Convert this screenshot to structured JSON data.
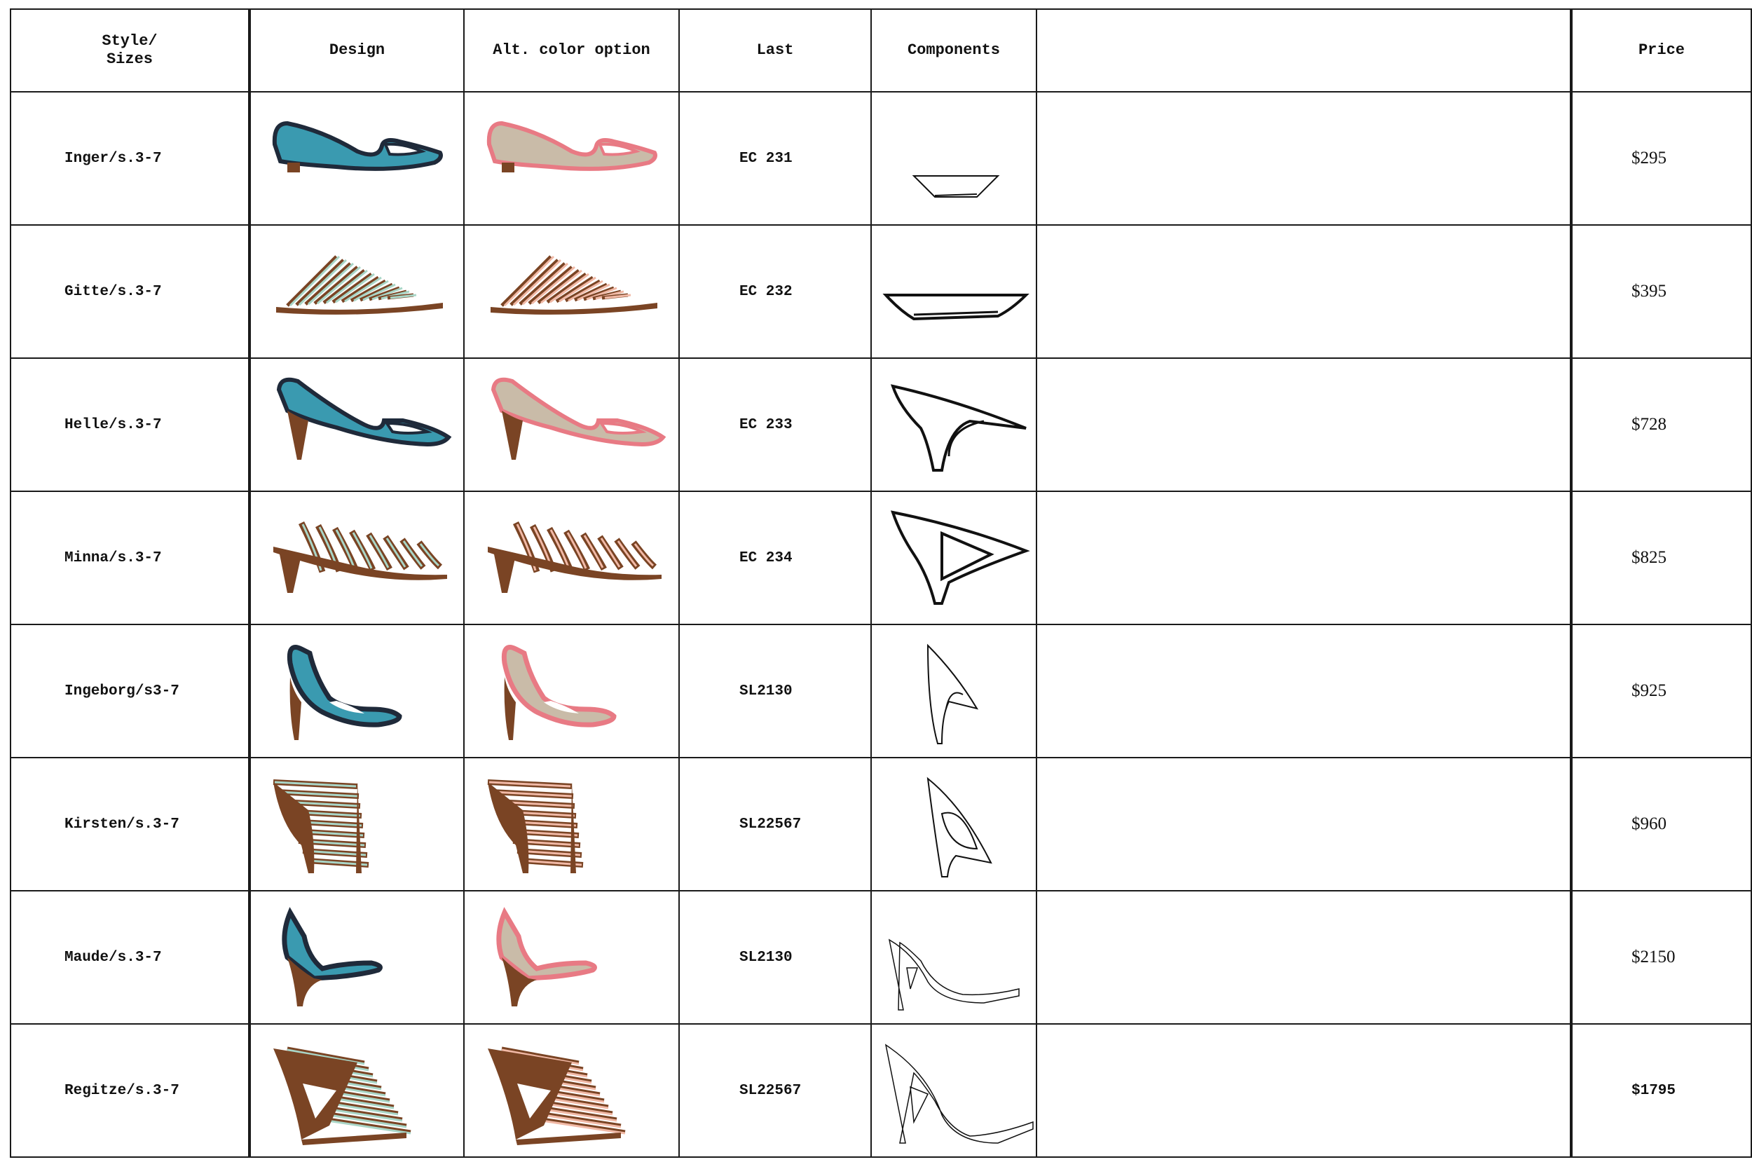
{
  "headers": {
    "style": "Style/\nSizes",
    "design": "Design",
    "alt": "Alt. color option",
    "last": "Last",
    "components": "Components",
    "blank": "",
    "price": "Price"
  },
  "colors": {
    "design_main": "#3a9ab0",
    "design_trim": "#1f2a3a",
    "alt_main": "#c9bba8",
    "alt_trim": "#e87a84",
    "wood": "#7a4424",
    "strap_green": "#a9d6c7",
    "strap_pink": "#f1b9a6"
  },
  "rows": [
    {
      "style": "Inger/s.3-7",
      "last": "EC 231",
      "price": "$295",
      "shoe": "flat",
      "comp": "sole-small",
      "icon": "flat-shoe-icon"
    },
    {
      "style": "Gitte/s.3-7",
      "last": "EC 232",
      "price": "$395",
      "shoe": "strappy-flat",
      "comp": "sole-large",
      "icon": "strappy-flat-icon"
    },
    {
      "style": "Helle/s.3-7",
      "last": "EC 233",
      "price": "$728",
      "shoe": "kitten-heel",
      "comp": "heel-curve",
      "icon": "kitten-heel-icon"
    },
    {
      "style": "Minna/s.3-7",
      "last": "EC 234",
      "price": "$825",
      "shoe": "strappy-kitten",
      "comp": "heel-triangle",
      "icon": "strappy-kitten-icon"
    },
    {
      "style": "Ingeborg/s3-7",
      "last": "SL2130",
      "price": "$925",
      "shoe": "pump",
      "comp": "heel-narrow",
      "icon": "pump-icon"
    },
    {
      "style": "Kirsten/s.3-7",
      "last": "SL22567",
      "price": "$960",
      "shoe": "cage-heel",
      "comp": "heel-cutout",
      "icon": "cage-heel-icon"
    },
    {
      "style": "Maude/s.3-7",
      "last": "SL2130",
      "price": "$2150",
      "shoe": "wedge-open",
      "comp": "wedge-outline",
      "icon": "open-wedge-icon"
    },
    {
      "style": "Regitze/s.3-7",
      "last": "SL22567",
      "price": "$1795",
      "shoe": "strappy-wedge",
      "comp": "wedge-large",
      "icon": "strappy-wedge-icon"
    }
  ]
}
